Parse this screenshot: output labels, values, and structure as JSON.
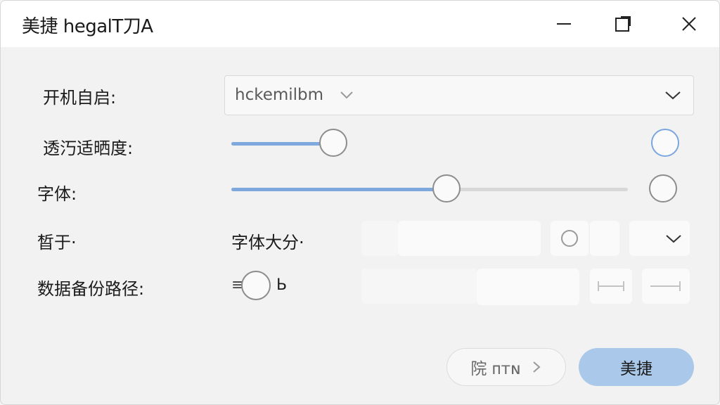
{
  "window": {
    "title": "美捷 hegalT刀A"
  },
  "settings": {
    "autostart_label": "开机自启:",
    "autostart_value": "hckemilbm",
    "transparency_label": "透汅适晒度:",
    "transparency_level": 0.25,
    "font_label": "字体:",
    "font_level": 0.53,
    "sub_label": "晳于·",
    "font_size_label": "字体大分·",
    "backup_label": "数据备份路径:",
    "toggle_prefix": "≡",
    "toggle_suffix": "Ь"
  },
  "footer": {
    "secondary_button": "院 ᴨᴛɴ",
    "primary_button": "美捷"
  },
  "colors": {
    "accent": "#7fa8dc",
    "primary_button_bg": "#a9c8ea"
  }
}
